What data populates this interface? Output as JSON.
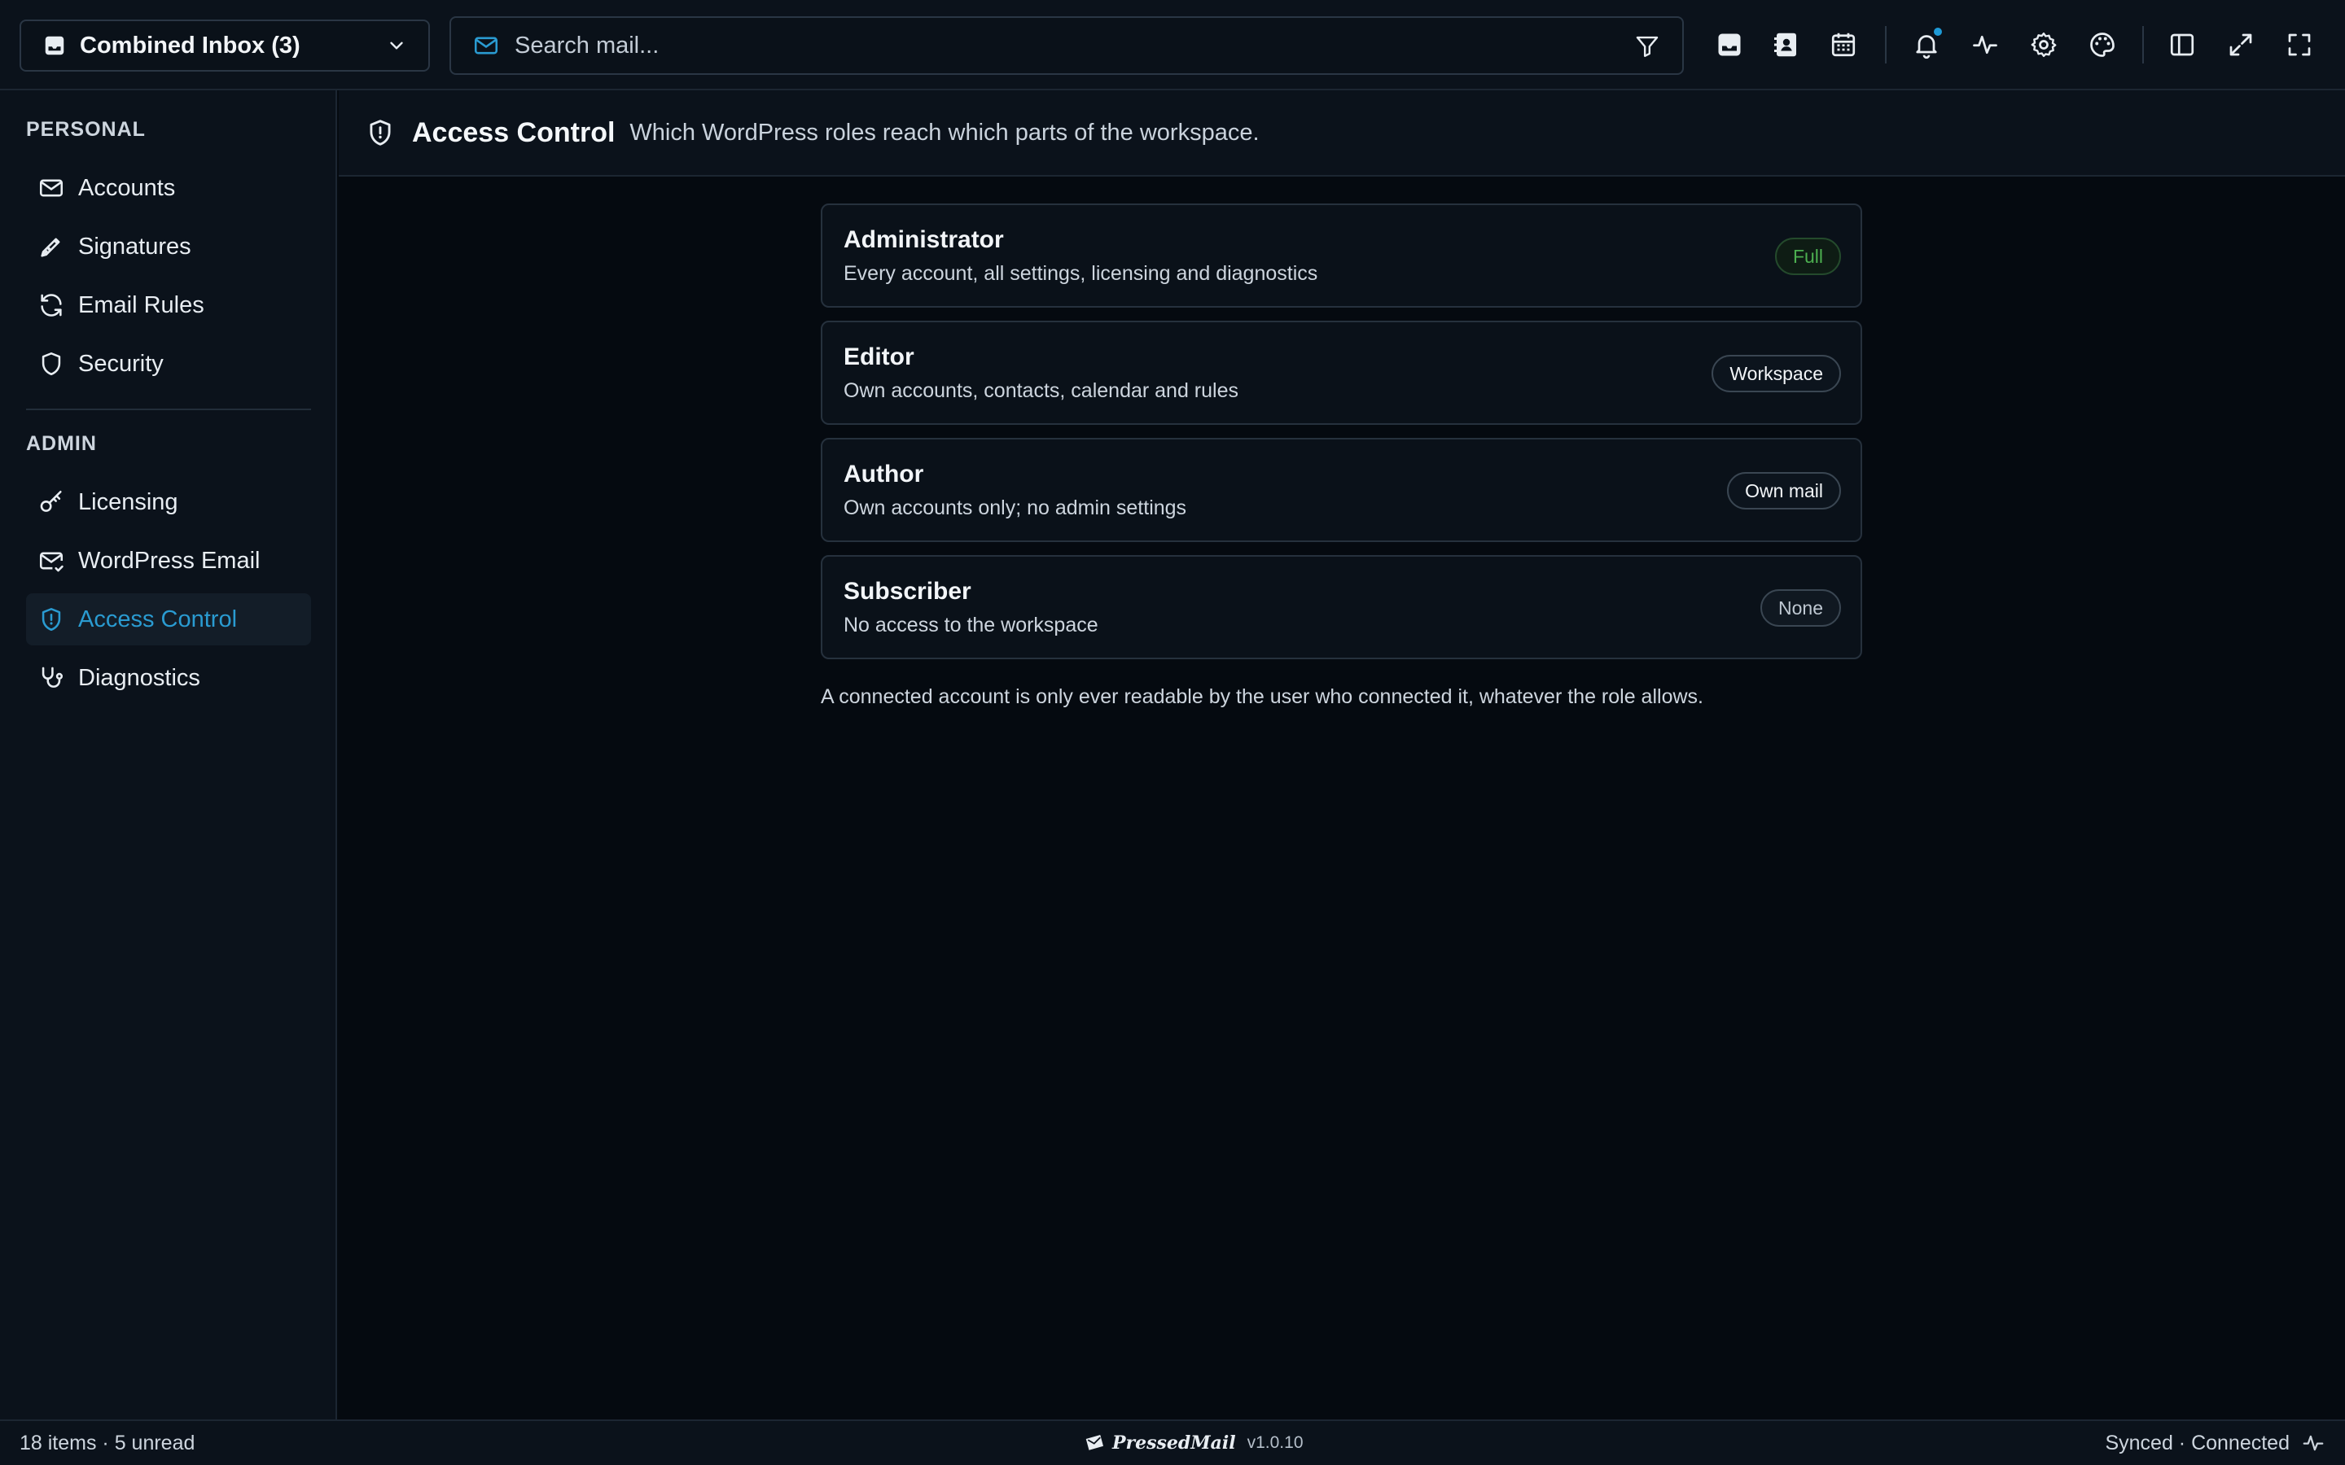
{
  "colors": {
    "background": "#050a10",
    "panel": "#0b121b",
    "accent": "#2a9bd1",
    "success": "#4caf50",
    "text": "#e8edf2"
  },
  "topbar": {
    "inbox_selector": {
      "label": "Combined Inbox (3)",
      "icon": "inbox-icon"
    },
    "search": {
      "placeholder": "Search mail...",
      "value": ""
    },
    "buttons": [
      "inbox-icon",
      "contacts-icon",
      "calendar-icon",
      "bell-icon",
      "activity-icon",
      "gear-icon",
      "palette-icon",
      "sidebar-toggle-icon",
      "expand-icon",
      "fullscreen-icon"
    ]
  },
  "sidebar": {
    "personal_title": "PERSONAL",
    "admin_title": "ADMIN",
    "personal_items": [
      {
        "label": "Accounts",
        "icon": "mail-icon"
      },
      {
        "label": "Signatures",
        "icon": "pen-icon"
      },
      {
        "label": "Email Rules",
        "icon": "refresh-icon"
      },
      {
        "label": "Security",
        "icon": "shield-icon"
      }
    ],
    "admin_items": [
      {
        "label": "Licensing",
        "icon": "key-icon"
      },
      {
        "label": "WordPress Email",
        "icon": "mail-check-icon"
      },
      {
        "label": "Access Control",
        "icon": "shield-alert-icon",
        "active": true
      },
      {
        "label": "Diagnostics",
        "icon": "stethoscope-icon"
      }
    ]
  },
  "main": {
    "title": "Access Control",
    "subtitle": "Which WordPress roles reach which parts of the workspace.",
    "roles": [
      {
        "name": "Administrator",
        "description": "Every account, all settings, licensing and diagnostics",
        "badge": "Full"
      },
      {
        "name": "Editor",
        "description": "Own accounts, contacts, calendar and rules",
        "badge": "Workspace"
      },
      {
        "name": "Author",
        "description": "Own accounts only; no admin settings",
        "badge": "Own mail"
      },
      {
        "name": "Subscriber",
        "description": "No access to the workspace",
        "badge": "None"
      }
    ],
    "note": "A connected account is only ever readable by the user who connected it, whatever the role allows."
  },
  "statusbar": {
    "counts": "18 items · 5 unread",
    "brand": "PressedMail",
    "version": "v1.0.10",
    "sync_status": "Synced · Connected"
  }
}
